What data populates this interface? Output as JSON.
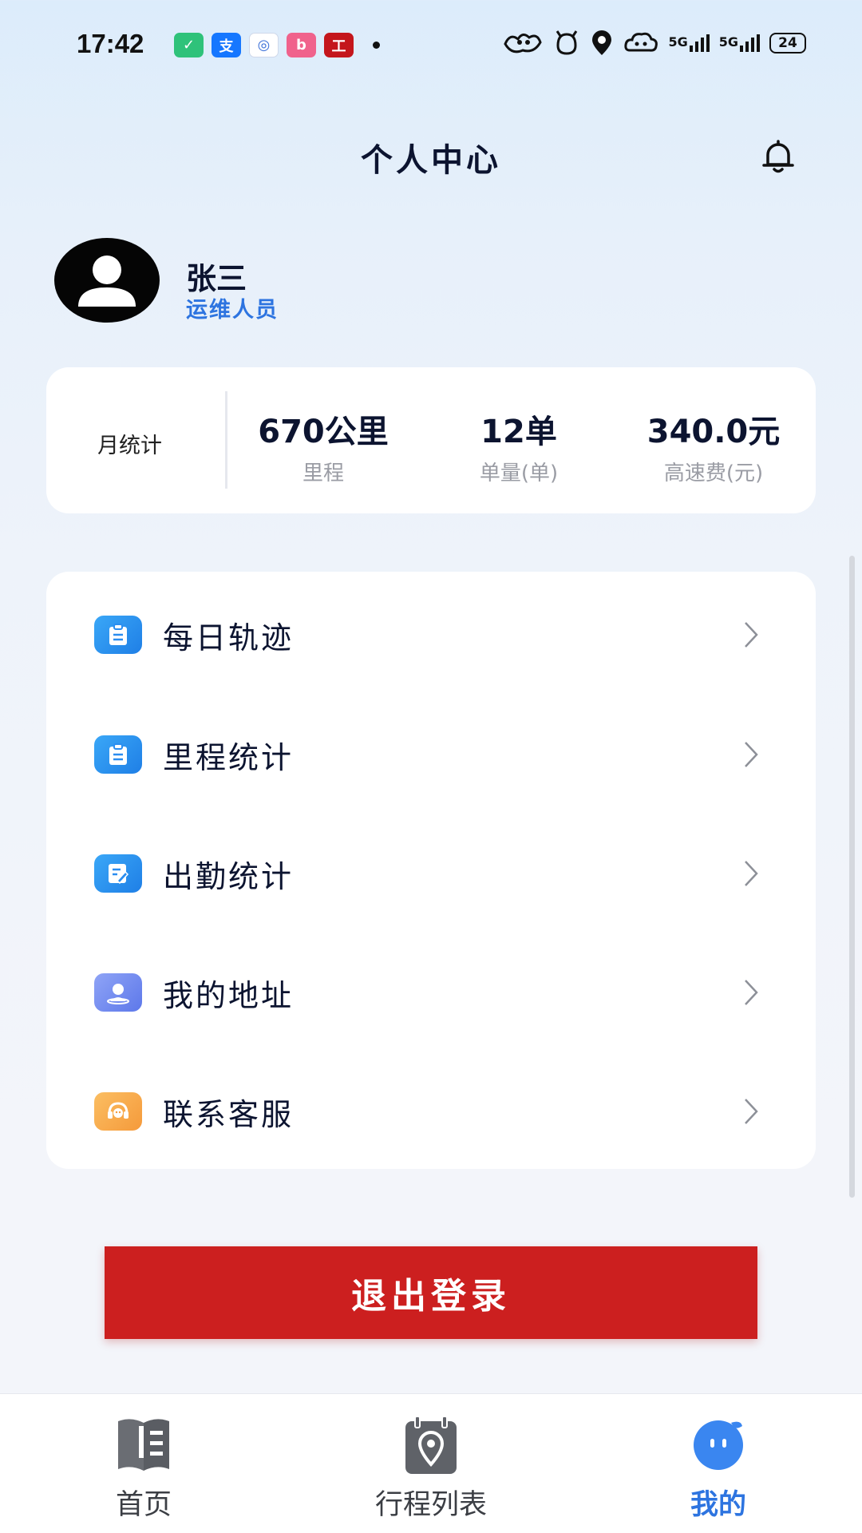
{
  "status_bar": {
    "time": "17:42",
    "apps": [
      {
        "name": "mi-home-icon",
        "glyph": "✓",
        "color": "#2fc27a"
      },
      {
        "name": "alipay-icon",
        "glyph": "支",
        "color": "#1677ff"
      },
      {
        "name": "bank-app-icon",
        "glyph": "◎",
        "color": "#3a6fd8"
      },
      {
        "name": "bilibili-icon",
        "glyph": "b",
        "color": "#f0628c"
      },
      {
        "name": "icbc-icon",
        "glyph": "工",
        "color": "#c4161c"
      }
    ],
    "network_1": "5G",
    "network_2": "5G",
    "battery": "24"
  },
  "header": {
    "title": "个人中心"
  },
  "profile": {
    "name": "张三",
    "role": "运维人员"
  },
  "stats": {
    "label": "月统计",
    "items": [
      {
        "value": "670公里",
        "label": "里程"
      },
      {
        "value": "12单",
        "label": "单量(单)"
      },
      {
        "value": "340.0元",
        "label": "高速费(元)"
      }
    ]
  },
  "menu": {
    "items": [
      {
        "label": "每日轨迹",
        "icon": "clipboard-icon",
        "color": "#2a8df0"
      },
      {
        "label": "里程统计",
        "icon": "clipboard-icon",
        "color": "#2a8df0"
      },
      {
        "label": "出勤统计",
        "icon": "edit-document-icon",
        "color": "#2a8df0"
      },
      {
        "label": "我的地址",
        "icon": "location-person-icon",
        "color": "#6f8cf2"
      },
      {
        "label": "联系客服",
        "icon": "headset-icon",
        "color": "#f7a94a"
      }
    ]
  },
  "logout": {
    "label": "退出登录",
    "color": "#cc1f1f"
  },
  "tabbar": {
    "tabs": [
      {
        "label": "首页",
        "icon": "book-icon",
        "active": false
      },
      {
        "label": "行程列表",
        "icon": "map-calendar-icon",
        "active": false
      },
      {
        "label": "我的",
        "icon": "chat-bubble-face-icon",
        "active": true
      }
    ],
    "active_color": "#2d74e0"
  }
}
